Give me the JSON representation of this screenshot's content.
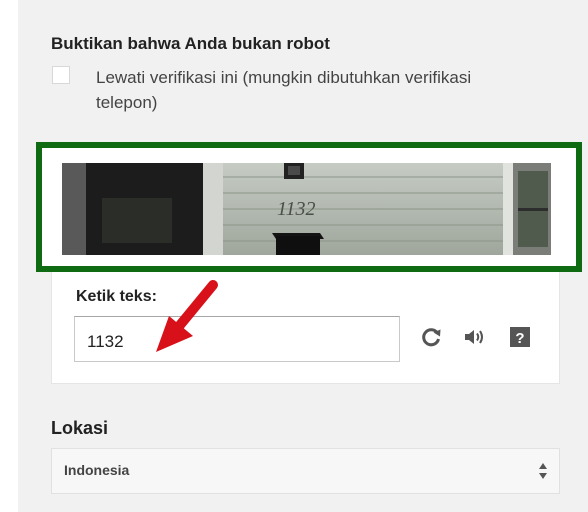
{
  "verification": {
    "heading": "Buktikan bahwa Anda bukan robot",
    "skip_checkbox_checked": false,
    "skip_label": "Lewati verifikasi ini (mungkin dibutuhkan verifikasi telepon)"
  },
  "captcha": {
    "image_text": "1132",
    "type_label": "Ketik teks:",
    "input_value": "1132",
    "highlight_color": "#0e6b11",
    "arrow_color": "#d8101a",
    "icons": [
      "refresh-icon",
      "audio-icon",
      "help-icon"
    ]
  },
  "location": {
    "label": "Lokasi",
    "selected_value": "Indonesia"
  }
}
